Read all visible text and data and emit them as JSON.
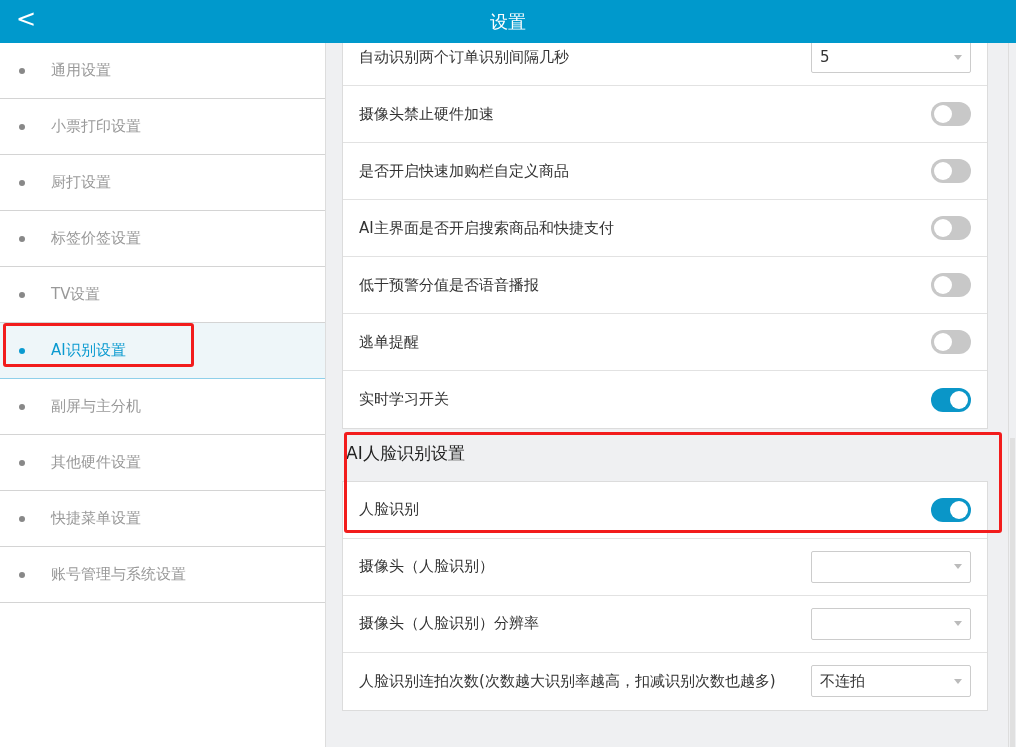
{
  "header": {
    "back": "<",
    "title": "设置"
  },
  "sidebar": {
    "items": [
      {
        "label": "通用设置",
        "selected": false,
        "highlighted": false
      },
      {
        "label": "小票打印设置",
        "selected": false,
        "highlighted": false
      },
      {
        "label": "厨打设置",
        "selected": false,
        "highlighted": false
      },
      {
        "label": "标签价签设置",
        "selected": false,
        "highlighted": false
      },
      {
        "label": "TV设置",
        "selected": false,
        "highlighted": false
      },
      {
        "label": "AI识别设置",
        "selected": true,
        "highlighted": true
      },
      {
        "label": "副屏与主分机",
        "selected": false,
        "highlighted": false
      },
      {
        "label": "其他硬件设置",
        "selected": false,
        "highlighted": false
      },
      {
        "label": "快捷菜单设置",
        "selected": false,
        "highlighted": false
      },
      {
        "label": "账号管理与系统设置",
        "selected": false,
        "highlighted": false
      }
    ]
  },
  "sections": [
    {
      "rows": [
        {
          "kind": "select",
          "label": "自动识别两个订单识别间隔几秒",
          "value": "5"
        },
        {
          "kind": "toggle",
          "label": "摄像头禁止硬件加速",
          "on": false
        },
        {
          "kind": "toggle",
          "label": "是否开启快速加购栏自定义商品",
          "on": false
        },
        {
          "kind": "toggle",
          "label": "AI主界面是否开启搜索商品和快捷支付",
          "on": false
        },
        {
          "kind": "toggle",
          "label": "低于预警分值是否语音播报",
          "on": false
        },
        {
          "kind": "toggle",
          "label": "逃单提醒",
          "on": false
        },
        {
          "kind": "toggle",
          "label": "实时学习开关",
          "on": true
        }
      ]
    },
    {
      "title": "AI人脸识别设置",
      "highlighted": true,
      "rows": [
        {
          "kind": "toggle",
          "label": "人脸识别",
          "on": true
        },
        {
          "kind": "select",
          "label": "摄像头（人脸识别）"
        },
        {
          "kind": "select",
          "label": "摄像头（人脸识别）分辨率"
        },
        {
          "kind": "select",
          "label": "人脸识别连拍次数(次数越大识别率越高，扣减识别次数也越多)",
          "value": "不连拍"
        }
      ]
    }
  ]
}
